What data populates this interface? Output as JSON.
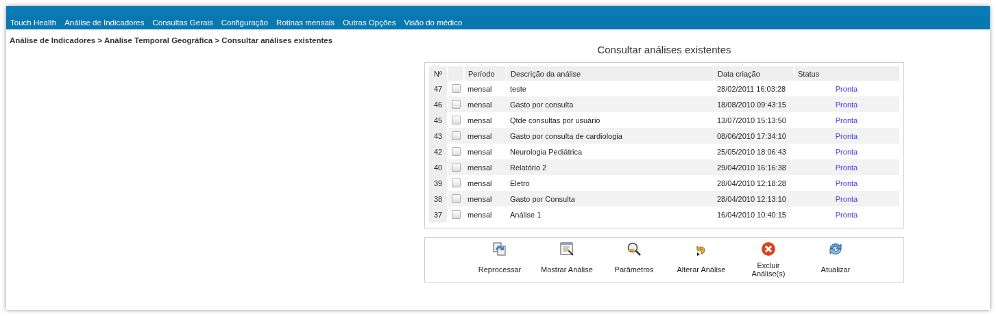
{
  "menu": [
    "Touch Health",
    "Análise de Indicadores",
    "Consultas Gerais",
    "Configuração",
    "Rotinas mensais",
    "Outras Opções",
    "Visão do médico"
  ],
  "breadcrumb": "Análise de Indicadores > Análise Temporal Geográfica > Consultar análises existentes",
  "title": "Consultar análises existentes",
  "table": {
    "columns": [
      "Nº",
      "",
      "Período",
      "Descrição da análise",
      "Data criação",
      "Status"
    ],
    "rows": [
      {
        "number": "47",
        "checked": false,
        "period": "mensal",
        "description": "teste",
        "created": "28/02/2011 16:03:28",
        "status": "Pronta"
      },
      {
        "number": "46",
        "checked": false,
        "period": "mensal",
        "description": "Gasto por consulta",
        "created": "18/08/2010 09:43:15",
        "status": "Pronta"
      },
      {
        "number": "45",
        "checked": false,
        "period": "mensal",
        "description": "Qtde consultas por usuário",
        "created": "13/07/2010 15:13:50",
        "status": "Pronta"
      },
      {
        "number": "43",
        "checked": false,
        "period": "mensal",
        "description": "Gasto por consulta de cardiologia",
        "created": "08/06/2010 17:34:10",
        "status": "Pronta"
      },
      {
        "number": "42",
        "checked": false,
        "period": "mensal",
        "description": "Neurologia Pediátrica",
        "created": "25/05/2010 18:06:43",
        "status": "Pronta"
      },
      {
        "number": "40",
        "checked": false,
        "period": "mensal",
        "description": "Relatório 2",
        "created": "29/04/2010 16:16:38",
        "status": "Pronta"
      },
      {
        "number": "39",
        "checked": false,
        "period": "mensal",
        "description": "Eletro",
        "created": "28/04/2010 12:18:28",
        "status": "Pronta"
      },
      {
        "number": "38",
        "checked": false,
        "period": "mensal",
        "description": "Gasto por Consulta",
        "created": "28/04/2010 12:13:10",
        "status": "Pronta"
      },
      {
        "number": "37",
        "checked": false,
        "period": "mensal",
        "description": "Análise 1",
        "created": "16/04/2010 10:40:15",
        "status": "Pronta"
      }
    ]
  },
  "actions": [
    {
      "kind": "reprocess",
      "label": "Reprocessar"
    },
    {
      "kind": "show",
      "label": "Mostrar Análise"
    },
    {
      "kind": "params",
      "label": "Parâmetros"
    },
    {
      "kind": "edit",
      "label": "Alterar Análise"
    },
    {
      "kind": "delete",
      "label": "Excluir Análise(s)"
    },
    {
      "kind": "refresh",
      "label": "Atualizar"
    }
  ]
}
